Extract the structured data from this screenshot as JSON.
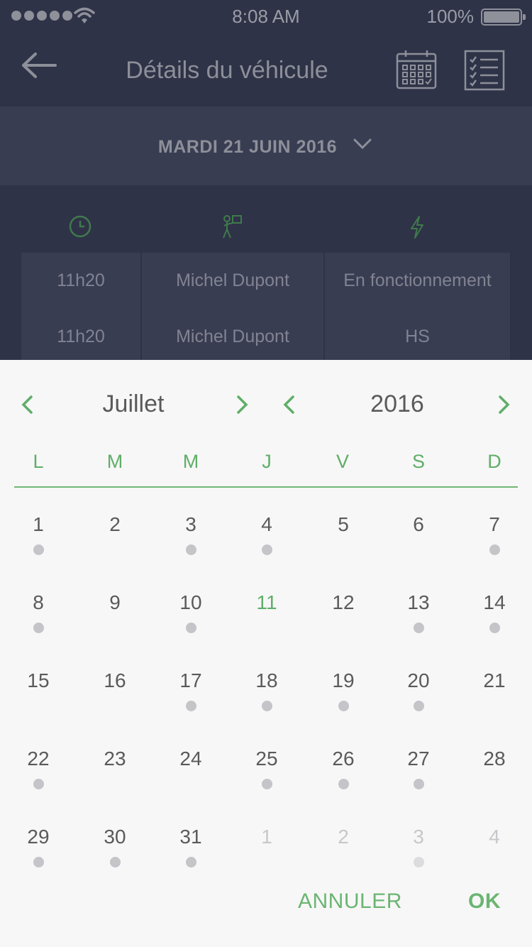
{
  "status": {
    "time": "8:08 AM",
    "battery": "100%"
  },
  "nav": {
    "title": "Détails du véhicule"
  },
  "datebar": {
    "label": "MARDI 21 JUIN 2016"
  },
  "table": [
    [
      "11h20",
      "Michel Dupont",
      "En fonctionnement"
    ],
    [
      "11h20",
      "Michel Dupont",
      "HS"
    ]
  ],
  "picker": {
    "month": "Juillet",
    "year": "2016",
    "weekdays": [
      "L",
      "M",
      "M",
      "J",
      "V",
      "S",
      "D"
    ],
    "weeks": [
      [
        {
          "d": "1",
          "dot": true
        },
        {
          "d": "2",
          "dot": false
        },
        {
          "d": "3",
          "dot": true
        },
        {
          "d": "4",
          "dot": true
        },
        {
          "d": "5",
          "dot": false
        },
        {
          "d": "6",
          "dot": false
        },
        {
          "d": "7",
          "dot": true
        }
      ],
      [
        {
          "d": "8",
          "dot": true
        },
        {
          "d": "9",
          "dot": false
        },
        {
          "d": "10",
          "dot": true
        },
        {
          "d": "11",
          "dot": false,
          "today": true
        },
        {
          "d": "12",
          "dot": false
        },
        {
          "d": "13",
          "dot": true
        },
        {
          "d": "14",
          "dot": true
        }
      ],
      [
        {
          "d": "15",
          "dot": false
        },
        {
          "d": "16",
          "dot": false
        },
        {
          "d": "17",
          "dot": true
        },
        {
          "d": "18",
          "dot": true
        },
        {
          "d": "19",
          "dot": true
        },
        {
          "d": "20",
          "dot": true
        },
        {
          "d": "21",
          "dot": false
        }
      ],
      [
        {
          "d": "22",
          "dot": true
        },
        {
          "d": "23",
          "dot": false
        },
        {
          "d": "24",
          "dot": false
        },
        {
          "d": "25",
          "dot": true
        },
        {
          "d": "26",
          "dot": true
        },
        {
          "d": "27",
          "dot": true
        },
        {
          "d": "28",
          "dot": false
        }
      ],
      [
        {
          "d": "29",
          "dot": true
        },
        {
          "d": "30",
          "dot": true
        },
        {
          "d": "31",
          "dot": true
        },
        {
          "d": "1",
          "dot": false,
          "other": true
        },
        {
          "d": "2",
          "dot": false,
          "other": true
        },
        {
          "d": "3",
          "dot": true,
          "other": true
        },
        {
          "d": "4",
          "dot": false,
          "other": true
        }
      ]
    ],
    "cancel_label": "ANNULER",
    "ok_label": "OK"
  },
  "colors": {
    "accent": "#5fae68",
    "header_bg": "#2f3347",
    "bar_bg": "#393d52",
    "sheet_bg": "#f7f7f7"
  }
}
